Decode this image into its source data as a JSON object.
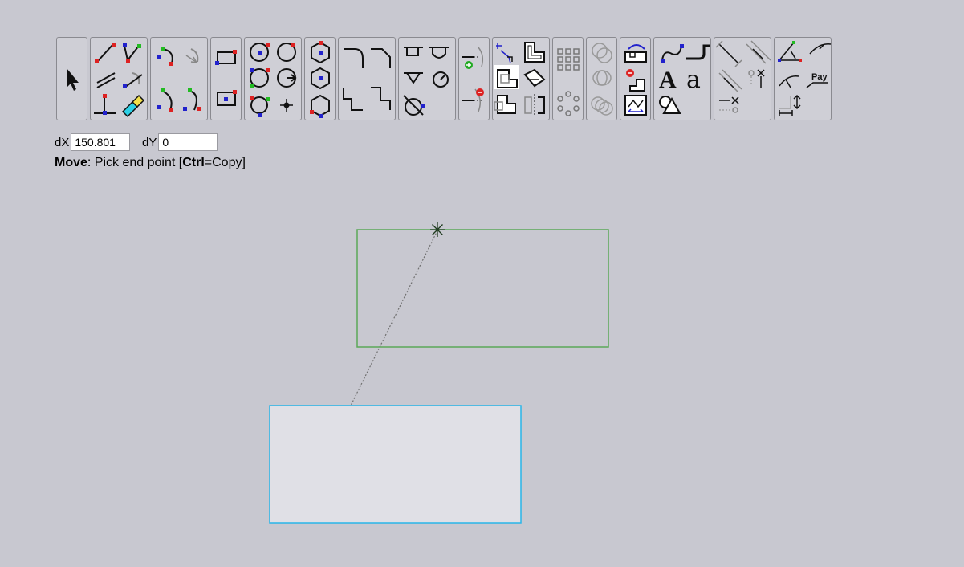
{
  "toolbar": {
    "groups": [
      {
        "id": "select",
        "icons": [
          "pointer-icon"
        ]
      },
      {
        "id": "lines",
        "icons": [
          "line-icon",
          "polyline-icon",
          "parallel-line-icon",
          "tangent-line-icon",
          "perpendicular-line-icon",
          "freehand-pencil-icon"
        ]
      },
      {
        "id": "arcs",
        "icons": [
          "arc-3point-icon",
          "arc-center-icon",
          "arc-start-end-icon",
          "arc-tangent-icon"
        ]
      },
      {
        "id": "rectangles",
        "icons": [
          "rectangle-corners-icon",
          "rectangle-center-icon"
        ]
      },
      {
        "id": "circles",
        "icons": [
          "circle-center-icon",
          "circle-3point-icon",
          "circle-2point-icon",
          "circle-radius-icon",
          "circle-tangent-icon",
          "point-icon"
        ]
      },
      {
        "id": "polygons",
        "icons": [
          "hexagon-center-icon",
          "hexagon-inscribed-icon",
          "hexagon-edge-icon"
        ]
      },
      {
        "id": "fillets",
        "icons": [
          "fillet-icon",
          "chamfer-icon",
          "corner-icon",
          "corner-trim-icon"
        ]
      },
      {
        "id": "grooves",
        "icons": [
          "slot-icon",
          "u-slot-icon",
          "v-groove-icon",
          "keyhole-icon",
          "circle-cut-icon"
        ]
      },
      {
        "id": "extend",
        "icons": [
          "extend-add-icon",
          "trim-remove-icon"
        ]
      },
      {
        "id": "boolean",
        "icons": [
          "move-copy-icon",
          "outline-icon",
          "union-icon",
          "rotate-shape-icon",
          "subtract-icon",
          "mirror-icon"
        ]
      },
      {
        "id": "arrays",
        "icons": [
          "rect-array-icon",
          "polar-array-icon"
        ]
      },
      {
        "id": "offset",
        "icons": [
          "offset-icon",
          "offset-inner-icon",
          "offset-multiple-icon"
        ]
      },
      {
        "id": "edit",
        "icons": [
          "convert-icon",
          "delete-node-icon",
          "fit-icon"
        ]
      },
      {
        "id": "text",
        "icons": [
          "bezier-icon",
          "path-icon",
          "text-sans-icon",
          "text-serif-icon",
          "shapes-icon"
        ]
      },
      {
        "id": "constraints",
        "icons": [
          "distance-constraint-icon",
          "parallel-constraint-icon",
          "tangent-constraint-icon",
          "point-on-constraint-icon",
          "horizontal-constraint-icon"
        ]
      },
      {
        "id": "dimensions",
        "icons": [
          "angle-dimension-icon",
          "radius-dimension-icon",
          "arc-dimension-icon",
          "pay-label-icon",
          "linear-dimension-icon"
        ]
      }
    ],
    "pay_label": "Pay",
    "text_sans_glyph": "A",
    "text_serif_glyph": "a"
  },
  "coords": {
    "dx_label": "dX",
    "dx_value": "150.801",
    "dy_label": "dY",
    "dy_value": "0"
  },
  "status": {
    "command": "Move",
    "prompt": ": Pick end point [",
    "modifier": "Ctrl",
    "suffix": "=Copy]"
  },
  "colors": {
    "background": "#c8c8d0",
    "ghost_outline": "#5aa858",
    "selected_outline": "#29b6e8",
    "selected_fill": "#e0e0e6",
    "guide_line": "#707070"
  }
}
